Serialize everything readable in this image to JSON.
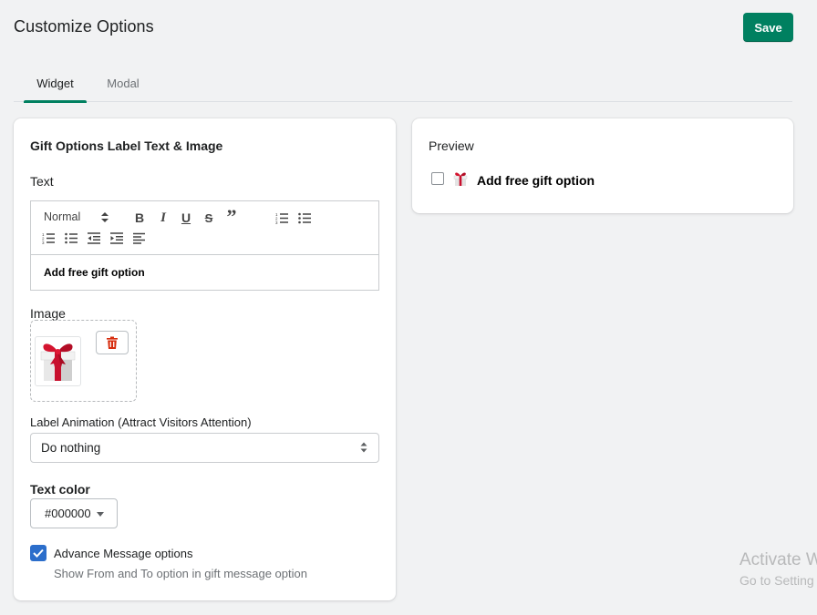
{
  "header": {
    "title": "Customize Options",
    "save_label": "Save"
  },
  "tabs": [
    {
      "label": "Widget",
      "active": true
    },
    {
      "label": "Modal",
      "active": false
    }
  ],
  "left_card": {
    "title": "Gift Options Label Text & Image",
    "text_label": "Text",
    "editor": {
      "format_value": "Normal",
      "content": "Add free gift option",
      "toolbar_icons": [
        "bold-icon",
        "italic-icon",
        "underline-icon",
        "strikethrough-icon",
        "blockquote-icon",
        "ordered-list-icon",
        "bullet-list-icon",
        "ordered-list-icon",
        "bullet-list-icon",
        "outdent-icon",
        "indent-icon",
        "align-left-icon"
      ],
      "bold": "B",
      "italic": "I",
      "underline": "U",
      "strike": "S",
      "quote": "”"
    },
    "image_label": "Image",
    "animation_label": "Label Animation (Attract Visitors Attention)",
    "animation_value": "Do nothing",
    "text_color_label": "Text color",
    "text_color_value": "#000000",
    "advance": {
      "checked": true,
      "label": "Advance Message options",
      "help": "Show From and To option in gift message option"
    }
  },
  "preview": {
    "title": "Preview",
    "checkbox_checked": false,
    "text": "Add free gift option"
  },
  "watermark": {
    "line1": "Activate W",
    "line2": "Go to Setting"
  },
  "colors": {
    "accent": "#008060",
    "checkbox": "#2c6ecb",
    "delete": "#d72c0d",
    "gift_red": "#c8102e"
  }
}
